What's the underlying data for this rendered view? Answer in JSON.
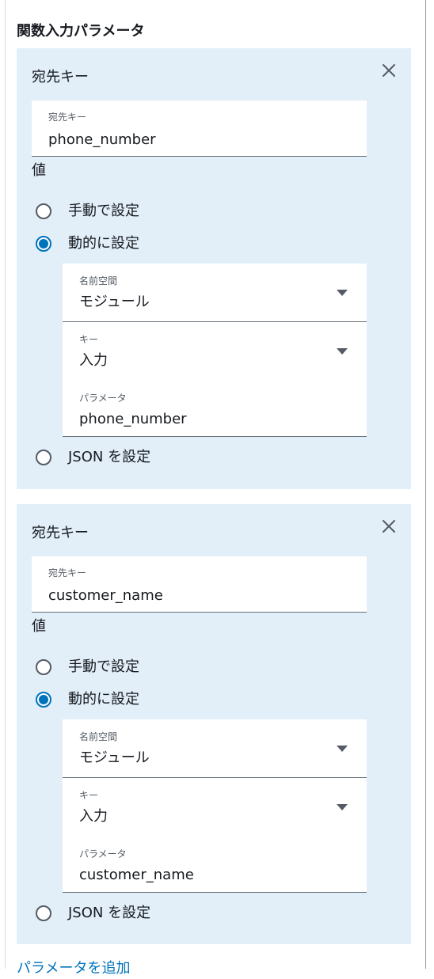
{
  "section": {
    "title": "関数入力パラメータ"
  },
  "cards": [
    {
      "title": "宛先キー",
      "close_icon": "close-icon",
      "key_field": {
        "label": "宛先キー",
        "value": "phone_number"
      },
      "value_label": "値",
      "radios": {
        "manual": "手動で設定",
        "dynamic": "動的に設定",
        "json": "JSON を設定",
        "selected": "dynamic"
      },
      "namespace": {
        "label": "名前空間",
        "value": "モジュール"
      },
      "key": {
        "label": "キー",
        "value": "入力"
      },
      "parameter": {
        "label": "パラメータ",
        "value": "phone_number"
      }
    },
    {
      "title": "宛先キー",
      "close_icon": "close-icon",
      "key_field": {
        "label": "宛先キー",
        "value": "customer_name"
      },
      "value_label": "値",
      "radios": {
        "manual": "手動で設定",
        "dynamic": "動的に設定",
        "json": "JSON を設定",
        "selected": "dynamic"
      },
      "namespace": {
        "label": "名前空間",
        "value": "モジュール"
      },
      "key": {
        "label": "キー",
        "value": "入力"
      },
      "parameter": {
        "label": "パラメータ",
        "value": "customer_name"
      }
    }
  ],
  "add_link": "パラメータを追加",
  "colors": {
    "panel": "#e2eff9",
    "accent": "#0073bb",
    "text": "#16191f"
  }
}
